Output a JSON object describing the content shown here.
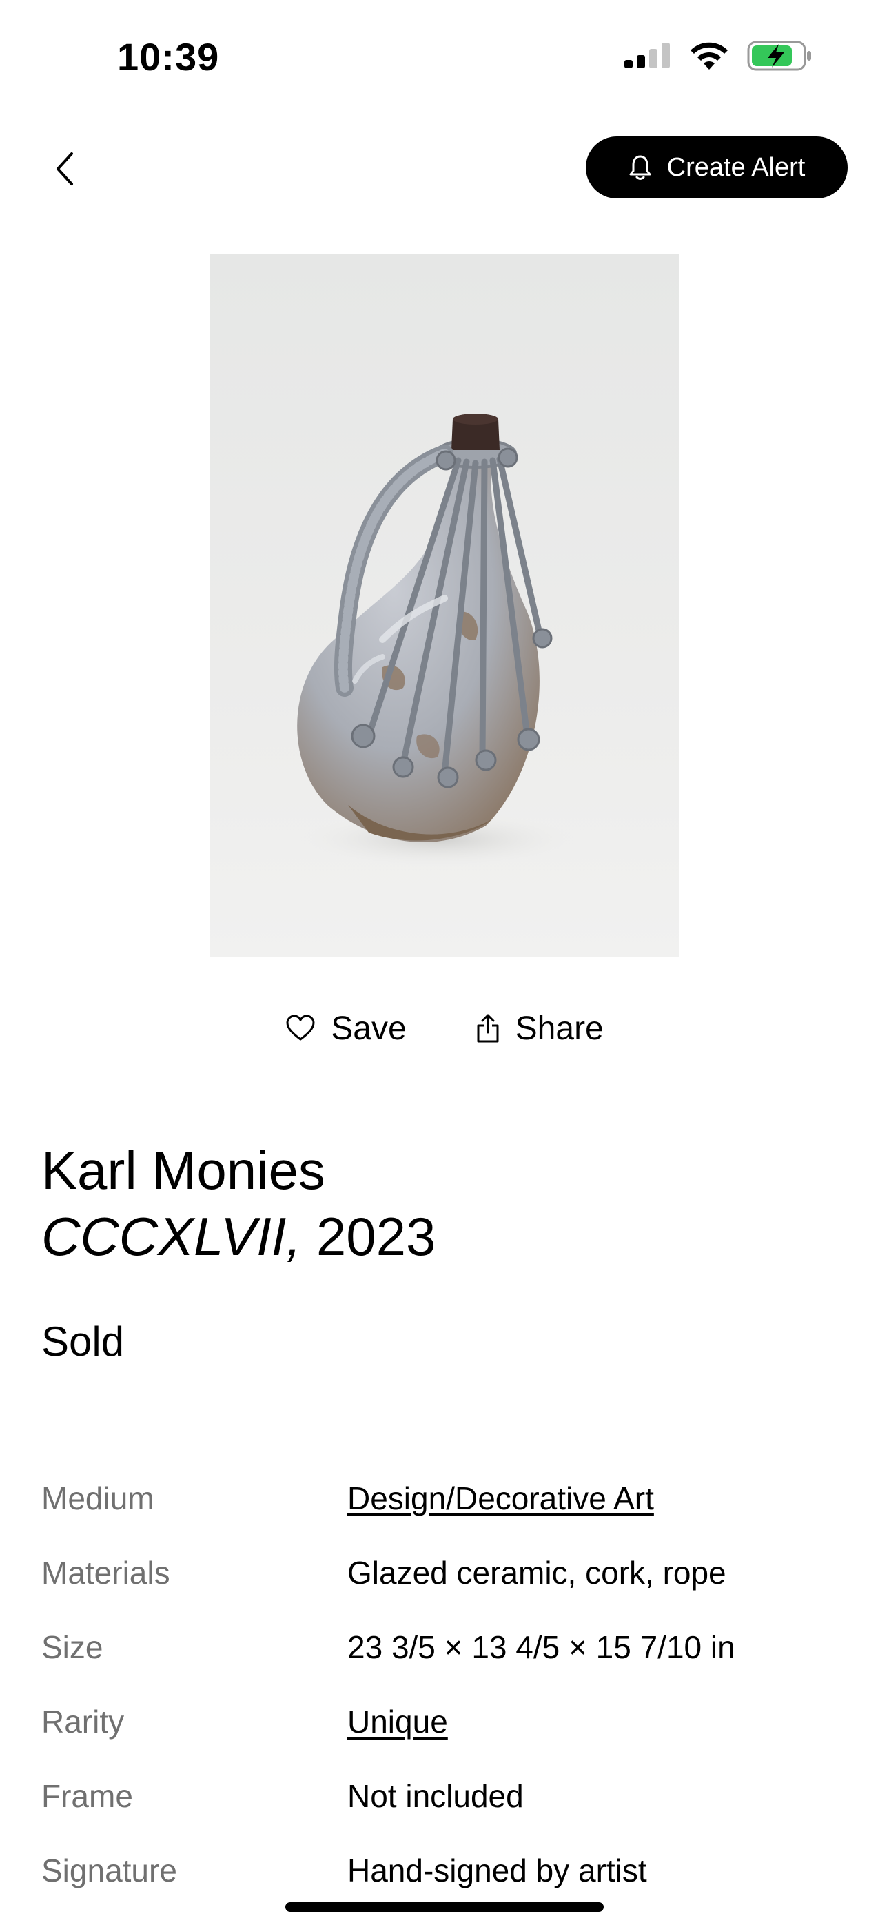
{
  "status_bar": {
    "time": "10:39"
  },
  "nav": {
    "back_icon": "chevron-left-icon",
    "create_alert_label": "Create Alert",
    "create_alert_icon": "bell-icon"
  },
  "actions": {
    "save_label": "Save",
    "share_label": "Share"
  },
  "artwork": {
    "artist": "Karl Monies",
    "title": "CCCXLVII,",
    "year": "2023",
    "availability": "Sold"
  },
  "details": [
    {
      "key": "Medium",
      "value": "Design/Decorative Art",
      "link": true
    },
    {
      "key": "Materials",
      "value": "Glazed ceramic, cork, rope",
      "link": false
    },
    {
      "key": "Size",
      "value": "23 3/5 × 13 4/5 × 15 7/10 in",
      "link": false
    },
    {
      "key": "Rarity",
      "value": "Unique",
      "link": true
    },
    {
      "key": "Frame",
      "value": "Not included",
      "link": false
    },
    {
      "key": "Signature",
      "value": "Hand-signed by artist",
      "link": false
    }
  ],
  "colors": {
    "accent": "#000000",
    "muted_label": "#707070",
    "battery_green": "#34c759"
  }
}
